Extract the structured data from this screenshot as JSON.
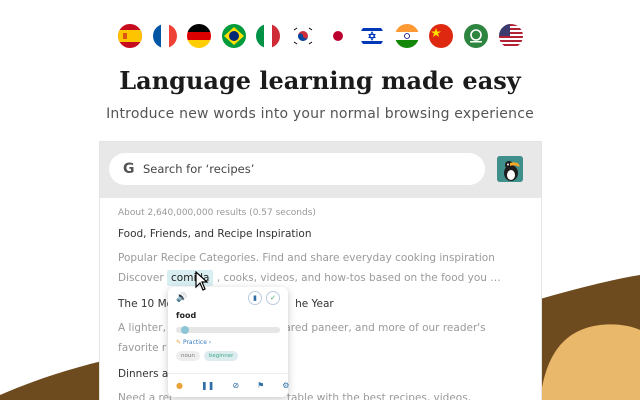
{
  "headline": "Language learning made easy",
  "subline": "Introduce new words into your normal browsing experience",
  "flags": [
    "spain-flag-icon",
    "france-flag-icon",
    "germany-flag-icon",
    "brazil-flag-icon",
    "italy-flag-icon",
    "korea-flag-icon",
    "japan-flag-icon",
    "israel-flag-icon",
    "india-flag-icon",
    "china-flag-icon",
    "saudi-flag-icon",
    "usa-flag-icon"
  ],
  "search": {
    "placeholder": "Search for ‘recipes’",
    "g_letter": "G"
  },
  "results": {
    "stat": "About 2,640,000,000 results (0.57 seconds)",
    "r1_title": "Food, Friends, and Recipe Inspiration",
    "r1_line1": "Popular Recipe Categories. Find and share everyday cooking inspiration",
    "r1_line2_a": "Discover",
    "r1_word": "comida",
    "r1_line2_b": ", cooks, videos, and how-tos based on the food you …",
    "r2_title_a": "The 10 Mo",
    "r2_title_b": "he Year",
    "r2_line1_a": "A lighter,",
    "r2_line1_b": "eared paneer, and more of our reader's",
    "r2_line2": "favorite r",
    "r3_title": "Dinners a",
    "r3_line1_a": "Need a rec",
    "r3_line1_b": "table with the best recipes, videos,"
  },
  "popup": {
    "word": "food",
    "practice": "Practice ›",
    "tag_noun": "noun",
    "tag_level": "beginner",
    "progress": 0.05
  },
  "colors": {
    "wave_dark": "#6e4a1f",
    "wave_light": "#e9b86a",
    "accent": "#3a7bbf"
  }
}
